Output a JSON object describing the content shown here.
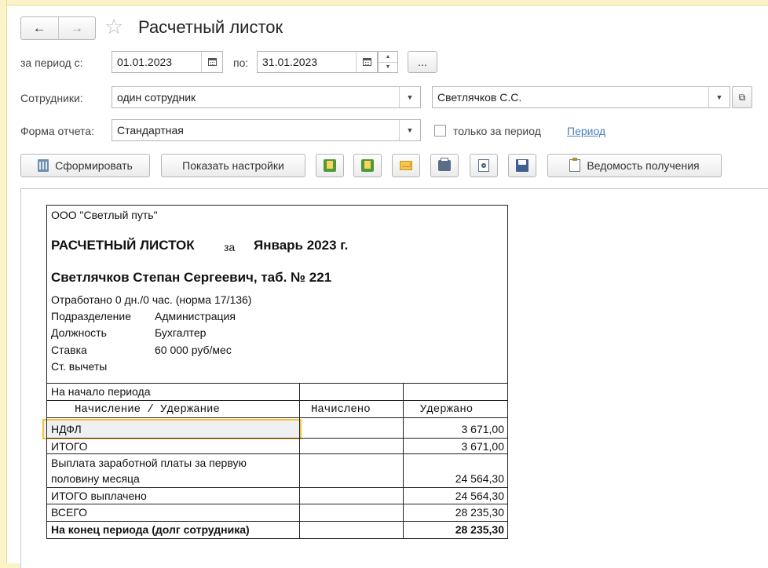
{
  "window": {
    "title": "Расчетный листок"
  },
  "filters": {
    "period_from_label": "за период с:",
    "period_from_value": "01.01.2023",
    "period_to_label": "по:",
    "period_to_value": "31.01.2023",
    "more_label": "...",
    "employees_label": "Сотрудники:",
    "employees_mode": "один сотрудник",
    "employee_name": "Светлячков С.С.",
    "form_label": "Форма отчета:",
    "form_value": "Стандартная",
    "only_period_label": "только за период",
    "period_link": "Период"
  },
  "toolbar": {
    "generate_label": "Сформировать",
    "show_settings_label": "Показать настройки",
    "receipt_statement_label": "Ведомость получения"
  },
  "report": {
    "company": "ООО \"Светлый путь\"",
    "title": "РАСЧЕТНЫЙ ЛИСТОК",
    "title_for": "за",
    "title_period": "Январь 2023 г.",
    "employee": "Светлячков Степан Сергеевич, таб. № 221",
    "worked": "Отработано 0 дн./0 час. (норма 17/136)",
    "dept_label": "Подразделение",
    "dept_value": "Администрация",
    "position_label": "Должность",
    "position_value": "Бухгалтер",
    "rate_label": "Ставка",
    "rate_value": "60 000 руб/мес",
    "deductions_label": "Ст. вычеты",
    "period_start": "На начало периода",
    "col_item": "Начисление / Удержание",
    "col_accrued": "Начислено",
    "col_withheld": "Удержано",
    "ndfl_label": "НДФЛ",
    "ndfl_value": "3 671,00",
    "total_label": "ИТОГО",
    "total_value": "3 671,00",
    "payout_label_1": "Выплата заработной платы за первую",
    "payout_label_2": "половину месяца",
    "payout_value": "24 564,30",
    "total_paid_label": "ИТОГО выплачено",
    "total_paid_value": "24 564,30",
    "grand_total_label": "ВСЕГО",
    "grand_total_value": "28 235,30",
    "end_label": "На конец периода (долг сотрудника)",
    "end_value": "28 235,30"
  }
}
